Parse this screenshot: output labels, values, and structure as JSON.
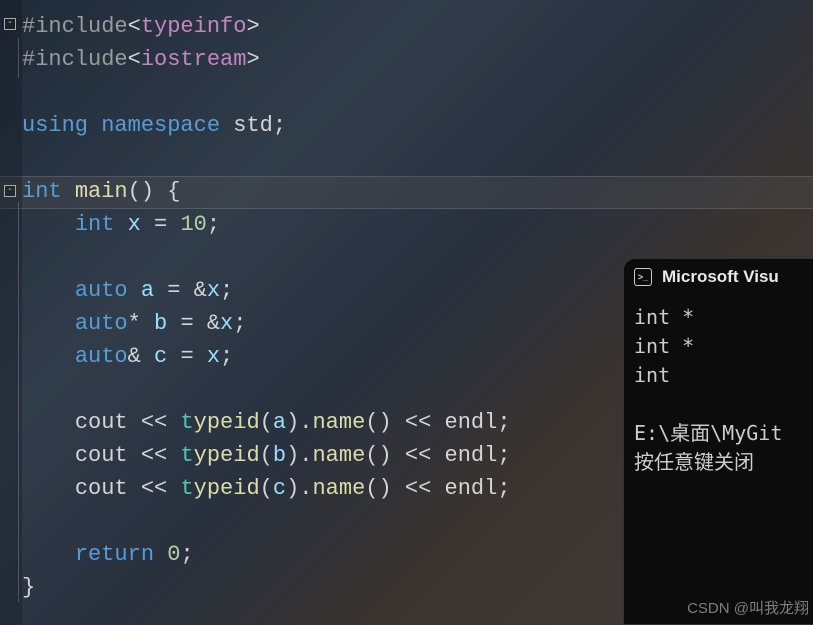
{
  "code": {
    "lines": [
      {
        "fold": "-",
        "tokens": [
          {
            "t": "k-preproc",
            "v": "#include"
          },
          {
            "t": "k-sym",
            "v": "<"
          },
          {
            "t": "k-header",
            "v": "typeinfo"
          },
          {
            "t": "k-sym",
            "v": ">"
          }
        ]
      },
      {
        "tokens": [
          {
            "t": "k-preproc",
            "v": "#include"
          },
          {
            "t": "k-sym",
            "v": "<"
          },
          {
            "t": "k-header",
            "v": "iostream"
          },
          {
            "t": "k-sym",
            "v": ">"
          }
        ]
      },
      {
        "tokens": []
      },
      {
        "tokens": [
          {
            "t": "k-keyword",
            "v": "using"
          },
          {
            "t": "k-white",
            "v": " "
          },
          {
            "t": "k-keyword",
            "v": "namespace"
          },
          {
            "t": "k-white",
            "v": " "
          },
          {
            "t": "k-id",
            "v": "std"
          },
          {
            "t": "k-punc",
            "v": ";"
          }
        ]
      },
      {
        "tokens": []
      },
      {
        "fold": "-",
        "highlight": true,
        "tokens": [
          {
            "t": "k-type",
            "v": "int"
          },
          {
            "t": "k-white",
            "v": " "
          },
          {
            "t": "k-func",
            "v": "main"
          },
          {
            "t": "k-punc",
            "v": "()"
          },
          {
            "t": "k-white",
            "v": " "
          },
          {
            "t": "k-punc",
            "v": "{"
          }
        ]
      },
      {
        "tokens": [
          {
            "t": "k-white",
            "v": "    "
          },
          {
            "t": "k-type",
            "v": "int"
          },
          {
            "t": "k-white",
            "v": " "
          },
          {
            "t": "k-var",
            "v": "x"
          },
          {
            "t": "k-white",
            "v": " "
          },
          {
            "t": "k-op",
            "v": "="
          },
          {
            "t": "k-white",
            "v": " "
          },
          {
            "t": "k-num",
            "v": "10"
          },
          {
            "t": "k-punc",
            "v": ";"
          }
        ]
      },
      {
        "tokens": []
      },
      {
        "tokens": [
          {
            "t": "k-white",
            "v": "    "
          },
          {
            "t": "k-type",
            "v": "auto"
          },
          {
            "t": "k-white",
            "v": " "
          },
          {
            "t": "k-var",
            "v": "a"
          },
          {
            "t": "k-white",
            "v": " "
          },
          {
            "t": "k-op",
            "v": "="
          },
          {
            "t": "k-white",
            "v": " "
          },
          {
            "t": "k-op",
            "v": "&"
          },
          {
            "t": "k-var",
            "v": "x"
          },
          {
            "t": "k-punc",
            "v": ";"
          }
        ]
      },
      {
        "tokens": [
          {
            "t": "k-white",
            "v": "    "
          },
          {
            "t": "k-type",
            "v": "auto"
          },
          {
            "t": "k-op",
            "v": "*"
          },
          {
            "t": "k-white",
            "v": " "
          },
          {
            "t": "k-var",
            "v": "b"
          },
          {
            "t": "k-white",
            "v": " "
          },
          {
            "t": "k-op",
            "v": "="
          },
          {
            "t": "k-white",
            "v": " "
          },
          {
            "t": "k-op",
            "v": "&"
          },
          {
            "t": "k-var",
            "v": "x"
          },
          {
            "t": "k-punc",
            "v": ";"
          }
        ]
      },
      {
        "tokens": [
          {
            "t": "k-white",
            "v": "    "
          },
          {
            "t": "k-type",
            "v": "auto"
          },
          {
            "t": "k-op",
            "v": "&"
          },
          {
            "t": "k-white",
            "v": " "
          },
          {
            "t": "k-var",
            "v": "c"
          },
          {
            "t": "k-white",
            "v": " "
          },
          {
            "t": "k-op",
            "v": "="
          },
          {
            "t": "k-white",
            "v": " "
          },
          {
            "t": "k-var",
            "v": "x"
          },
          {
            "t": "k-punc",
            "v": ";"
          }
        ]
      },
      {
        "tokens": []
      },
      {
        "tokens": [
          {
            "t": "k-white",
            "v": "    "
          },
          {
            "t": "k-id",
            "v": "cout"
          },
          {
            "t": "k-white",
            "v": " "
          },
          {
            "t": "k-op",
            "v": "<<"
          },
          {
            "t": "k-white",
            "v": " "
          },
          {
            "t": "k-t",
            "v": "t"
          },
          {
            "t": "k-func",
            "v": "ypeid"
          },
          {
            "t": "k-punc",
            "v": "("
          },
          {
            "t": "k-var",
            "v": "a"
          },
          {
            "t": "k-punc",
            "v": ")"
          },
          {
            "t": "k-op",
            "v": "."
          },
          {
            "t": "k-func",
            "v": "name"
          },
          {
            "t": "k-punc",
            "v": "()"
          },
          {
            "t": "k-white",
            "v": " "
          },
          {
            "t": "k-op",
            "v": "<<"
          },
          {
            "t": "k-white",
            "v": " "
          },
          {
            "t": "k-id",
            "v": "endl"
          },
          {
            "t": "k-punc",
            "v": ";"
          }
        ]
      },
      {
        "tokens": [
          {
            "t": "k-white",
            "v": "    "
          },
          {
            "t": "k-id",
            "v": "cout"
          },
          {
            "t": "k-white",
            "v": " "
          },
          {
            "t": "k-op",
            "v": "<<"
          },
          {
            "t": "k-white",
            "v": " "
          },
          {
            "t": "k-t",
            "v": "t"
          },
          {
            "t": "k-func",
            "v": "ypeid"
          },
          {
            "t": "k-punc",
            "v": "("
          },
          {
            "t": "k-var",
            "v": "b"
          },
          {
            "t": "k-punc",
            "v": ")"
          },
          {
            "t": "k-op",
            "v": "."
          },
          {
            "t": "k-func",
            "v": "name"
          },
          {
            "t": "k-punc",
            "v": "()"
          },
          {
            "t": "k-white",
            "v": " "
          },
          {
            "t": "k-op",
            "v": "<<"
          },
          {
            "t": "k-white",
            "v": " "
          },
          {
            "t": "k-id",
            "v": "endl"
          },
          {
            "t": "k-punc",
            "v": ";"
          }
        ]
      },
      {
        "tokens": [
          {
            "t": "k-white",
            "v": "    "
          },
          {
            "t": "k-id",
            "v": "cout"
          },
          {
            "t": "k-white",
            "v": " "
          },
          {
            "t": "k-op",
            "v": "<<"
          },
          {
            "t": "k-white",
            "v": " "
          },
          {
            "t": "k-t",
            "v": "t"
          },
          {
            "t": "k-func",
            "v": "ypeid"
          },
          {
            "t": "k-punc",
            "v": "("
          },
          {
            "t": "k-var",
            "v": "c"
          },
          {
            "t": "k-punc",
            "v": ")"
          },
          {
            "t": "k-op",
            "v": "."
          },
          {
            "t": "k-func",
            "v": "name"
          },
          {
            "t": "k-punc",
            "v": "()"
          },
          {
            "t": "k-white",
            "v": " "
          },
          {
            "t": "k-op",
            "v": "<<"
          },
          {
            "t": "k-white",
            "v": " "
          },
          {
            "t": "k-id",
            "v": "endl"
          },
          {
            "t": "k-punc",
            "v": ";"
          }
        ]
      },
      {
        "tokens": []
      },
      {
        "tokens": [
          {
            "t": "k-white",
            "v": "    "
          },
          {
            "t": "k-keyword",
            "v": "return"
          },
          {
            "t": "k-white",
            "v": " "
          },
          {
            "t": "k-num",
            "v": "0"
          },
          {
            "t": "k-punc",
            "v": ";"
          }
        ]
      },
      {
        "tokens": [
          {
            "t": "k-punc",
            "v": "}"
          }
        ]
      }
    ]
  },
  "terminal": {
    "title": "Microsoft Visu",
    "output": "int *\nint *\nint\n\nE:\\桌面\\MyGit\n按任意键关闭"
  },
  "watermark": "CSDN @叫我龙翔"
}
